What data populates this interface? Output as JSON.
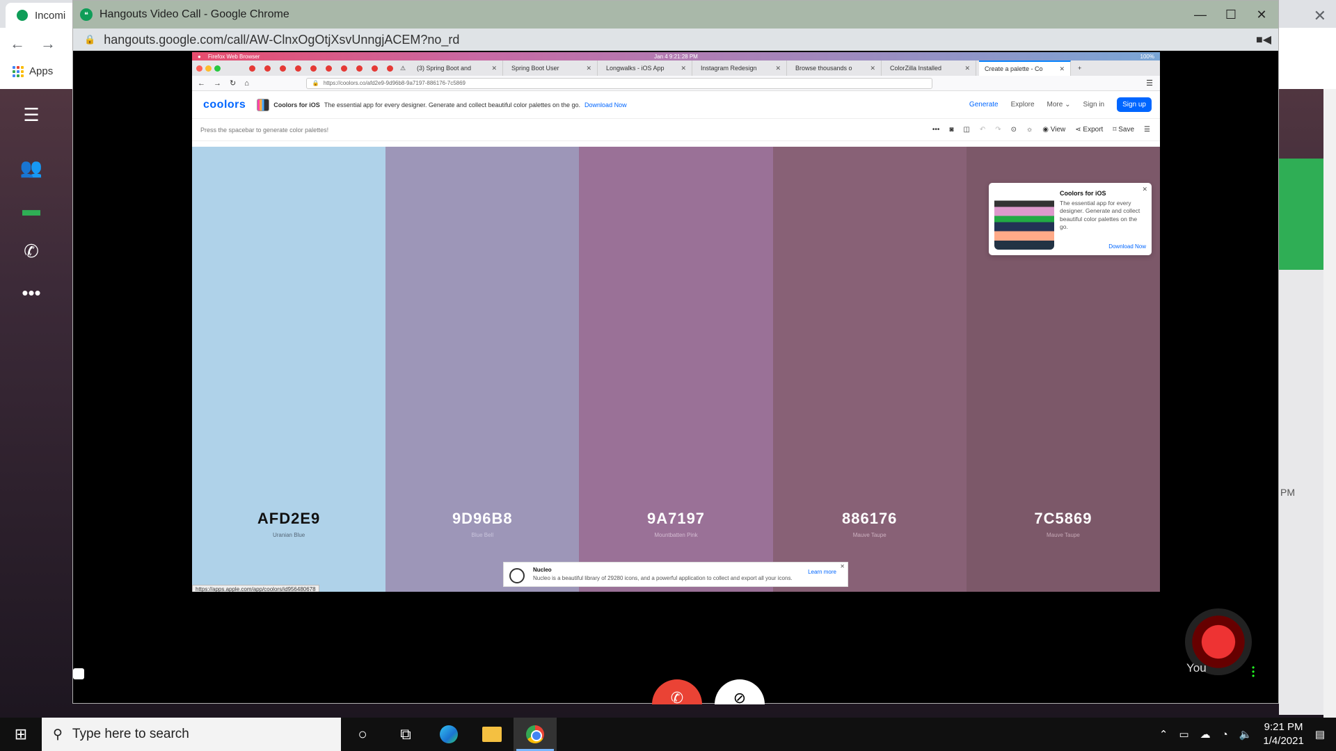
{
  "bg_chrome": {
    "tab_title": "Incomi",
    "apps_label": "Apps"
  },
  "popup": {
    "title": "Hangouts Video Call - Google Chrome",
    "url": "hangouts.google.com/call/AW-ClnxOgOtjXsvUnngjACEM?no_rd"
  },
  "mac_menubar": {
    "app": "Firefox Web Browser",
    "datetime": "Jan 4   9:21:28 PM",
    "battery": "100%"
  },
  "firefox": {
    "tabs": [
      {
        "label": "(3) Spring Boot and",
        "active": false
      },
      {
        "label": "Spring Boot User",
        "active": false
      },
      {
        "label": "Longwalks - iOS App",
        "active": false
      },
      {
        "label": "Instagram Redesign",
        "active": false
      },
      {
        "label": "Browse thousands o",
        "active": false
      },
      {
        "label": "ColorZilla Installed",
        "active": false
      },
      {
        "label": "Create a palette - Co",
        "active": true
      }
    ],
    "address": "https://coolors.co/afd2e9-9d96b8-9a7197-886176-7c5869"
  },
  "coolors": {
    "logo": "coolors",
    "promo_title": "Coolors for iOS",
    "promo_text": "The essential app for every designer. Generate and collect beautiful color palettes on the go.",
    "promo_link": "Download Now",
    "nav": {
      "generate": "Generate",
      "explore": "Explore",
      "more": "More",
      "signin": "Sign in",
      "signup": "Sign up"
    },
    "hint": "Press the spacebar to generate color palettes!",
    "toolbar": {
      "view": "View",
      "export": "Export",
      "save": "Save"
    },
    "swatches": [
      {
        "hex": "AFD2E9",
        "name": "Uranian Blue",
        "color": "#AFD2E9",
        "text": "#111111",
        "sub": "#556677"
      },
      {
        "hex": "9D96B8",
        "name": "Blue Bell",
        "color": "#9D96B8",
        "text": "#ffffff",
        "sub": "#c9c4dc"
      },
      {
        "hex": "9A7197",
        "name": "Mountbatten Pink",
        "color": "#9A7197",
        "text": "#ffffff",
        "sub": "#d4bcd2"
      },
      {
        "hex": "886176",
        "name": "Mauve Taupe",
        "color": "#886176",
        "text": "#ffffff",
        "sub": "#cdb1c0"
      },
      {
        "hex": "7C5869",
        "name": "Mauve Taupe",
        "color": "#7C5869",
        "text": "#ffffff",
        "sub": "#c6a9b6"
      }
    ],
    "ios_popup": {
      "title": "Coolors for iOS",
      "desc": "The essential app for every designer. Generate and collect beautiful color palettes on the go.",
      "link": "Download Now"
    },
    "nucleo": {
      "title": "Nucleo",
      "desc": "Nucleo is a beautiful library of 29280 icons, and a powerful application to collect and export all your icons.",
      "link": "Learn more"
    },
    "status_url": "https://apps.apple.com/app/coolors/id956480678"
  },
  "call": {
    "self_label": "You"
  },
  "bg_right": {
    "time": "PM"
  },
  "taskbar": {
    "search_placeholder": "Type here to search",
    "time": "9:21 PM",
    "date": "1/4/2021"
  }
}
